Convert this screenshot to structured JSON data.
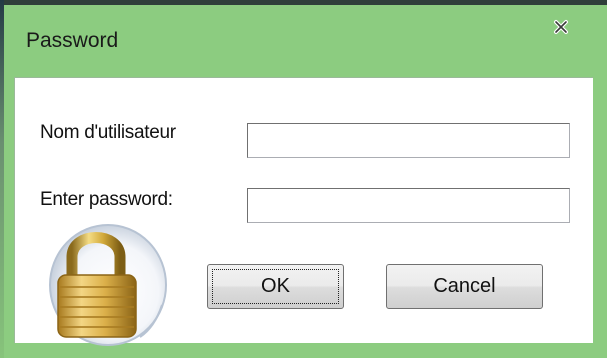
{
  "window": {
    "title": "Password",
    "close_icon": "close-icon",
    "colors": {
      "frame": "#8ccc80",
      "client": "#ffffff"
    }
  },
  "form": {
    "username_label": "Nom d'utilisateur",
    "username_value": "",
    "password_label": "Enter password:",
    "password_value": ""
  },
  "icon": {
    "name": "padlock-icon"
  },
  "buttons": {
    "ok_label": "OK",
    "cancel_label": "Cancel"
  }
}
